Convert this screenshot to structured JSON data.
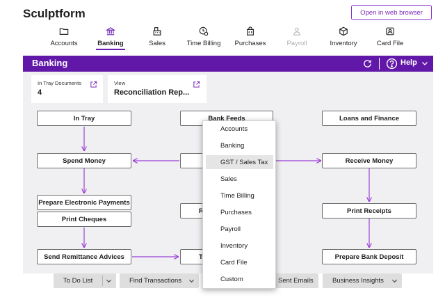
{
  "app": {
    "title": "Sculptform",
    "open_web_label": "Open in web browser"
  },
  "nav": [
    {
      "label": "Accounts",
      "icon": "folder-icon"
    },
    {
      "label": "Banking",
      "icon": "bank-icon",
      "active": true
    },
    {
      "label": "Sales",
      "icon": "cash-register-icon"
    },
    {
      "label": "Time Billing",
      "icon": "clock-dollar-icon"
    },
    {
      "label": "Purchases",
      "icon": "shopping-bag-icon"
    },
    {
      "label": "Payroll",
      "icon": "people-icon",
      "disabled": true
    },
    {
      "label": "Inventory",
      "icon": "box-icon"
    },
    {
      "label": "Card File",
      "icon": "contact-card-icon"
    }
  ],
  "banner": {
    "title": "Banking",
    "help_label": "Help"
  },
  "cards": {
    "in_tray": {
      "label": "In Tray Documents",
      "value": "4"
    },
    "view": {
      "label": "View",
      "value": "Reconciliation Rep..."
    }
  },
  "flow": {
    "in_tray": "In Tray",
    "bank_feeds": "Bank Feeds",
    "loans": "Loans and Finance",
    "spend_money": "Spend Money",
    "receive_money": "Receive Money",
    "prepare_electronic": "Prepare Electronic Payments",
    "print_cheques": "Print Cheques",
    "print_receipts": "Print Receipts",
    "send_remittance": "Send Remittance Advices",
    "prepare_deposit": "Prepare Bank Deposit",
    "mid_reconcile_partial": "Re",
    "mid_transfer_partial": "Tr"
  },
  "bottom": {
    "todo": "To Do List",
    "find": "Find Transactions",
    "sent_emails": "Sent Emails",
    "insights": "Business Insights"
  },
  "dropdown": {
    "items": [
      "Accounts",
      "Banking",
      "GST / Sales Tax",
      "Sales",
      "Time Billing",
      "Purchases",
      "Payroll",
      "Inventory",
      "Card File",
      "Custom"
    ],
    "highlighted": "GST / Sales Tax"
  },
  "colors": {
    "accent": "#6118a8",
    "arrow": "#9b3fd6"
  }
}
